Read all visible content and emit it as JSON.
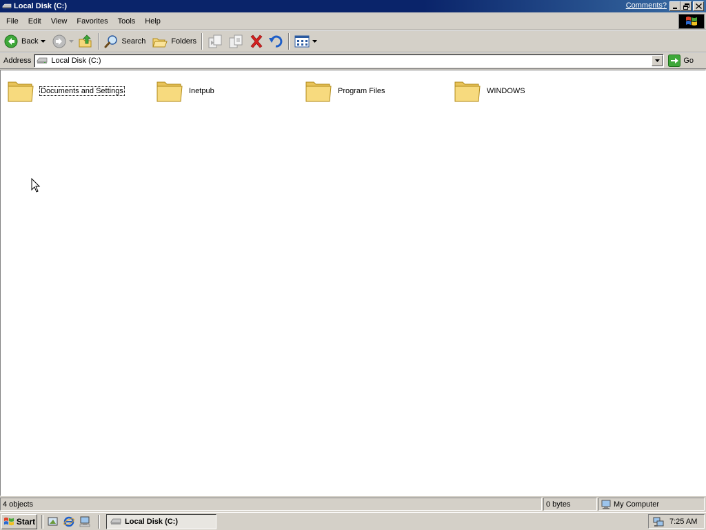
{
  "window": {
    "title": "Local Disk (C:)",
    "comments_link": "Comments?"
  },
  "menu": {
    "items": [
      {
        "label": "File"
      },
      {
        "label": "Edit"
      },
      {
        "label": "View"
      },
      {
        "label": "Favorites"
      },
      {
        "label": "Tools"
      },
      {
        "label": "Help"
      }
    ]
  },
  "toolbar": {
    "back_label": "Back",
    "search_label": "Search",
    "folders_label": "Folders"
  },
  "address": {
    "label": "Address",
    "value": "Local Disk (C:)",
    "go_label": "Go"
  },
  "files": [
    {
      "name": "Documents and Settings",
      "icon": "folder-icon"
    },
    {
      "name": "Inetpub",
      "icon": "folder-icon"
    },
    {
      "name": "Program Files",
      "icon": "folder-icon"
    },
    {
      "name": "WINDOWS",
      "icon": "folder-icon"
    }
  ],
  "status": {
    "objects": "4 objects",
    "size": "0 bytes",
    "zone": "My Computer"
  },
  "taskbar": {
    "start_label": "Start",
    "task_label": "Local Disk (C:)",
    "clock": "7:25 AM"
  },
  "colors": {
    "titlebar": "#0a246a",
    "face": "#d4d0c8",
    "folder": "#f5d77a",
    "go_green": "#3fa83a"
  }
}
